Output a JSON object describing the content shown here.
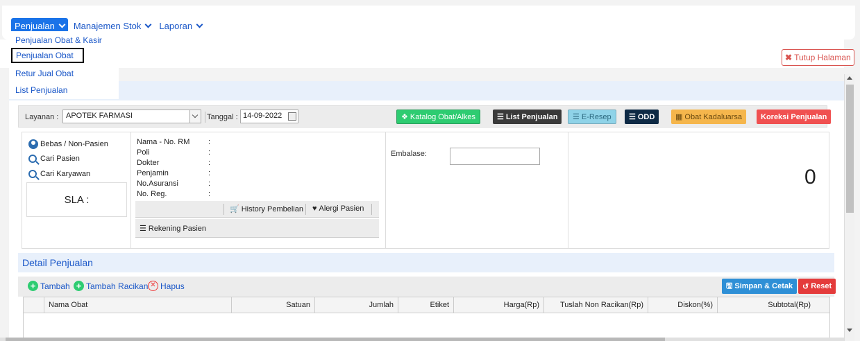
{
  "nav": {
    "items": [
      {
        "label": "Penjualan"
      },
      {
        "label": "Manajemen Stok"
      },
      {
        "label": "Laporan"
      }
    ],
    "dropdown": [
      {
        "label": "Penjualan Obat & Kasir"
      },
      {
        "label": "Penjualan Obat"
      },
      {
        "label": "Retur Jual Obat"
      },
      {
        "label": "List Penjualan"
      }
    ]
  },
  "header": {
    "close_label": "Tutup Halaman"
  },
  "toolbar": {
    "layanan_label": "Layanan :",
    "layanan_value": "APOTEK FARMASI",
    "tanggal_label": "Tanggal :",
    "tanggal_value": "14-09-2022",
    "buttons": {
      "katalog": "Katalog Obat/Alkes",
      "list": "List Penjualan",
      "eresep": "E-Resep",
      "odd": "ODD",
      "kadaluarsa": "Obat Kadaluarsa",
      "koreksi": "Koreksi Penjualan"
    }
  },
  "patient": {
    "options": [
      "Bebas / Non-Pasien",
      "Cari Pasien",
      "Cari Karyawan"
    ],
    "sla": "SLA :",
    "fields": [
      "Nama - No. RM",
      "Poli",
      "Dokter",
      "Penjamin",
      "No.Asuransi",
      "No. Reg."
    ],
    "colon": ":",
    "history": "History Pembelian",
    "alergi": "Alergi Pasien",
    "rekening": "Rekening Pasien",
    "embalase_label": "Embalase:",
    "total": "0"
  },
  "detail": {
    "title": "Detail Penjualan",
    "tambah": "Tambah",
    "tambah_racikan": "Tambah Racikan",
    "hapus": "Hapus",
    "simpan": "Simpan & Cetak",
    "reset": "Reset",
    "columns": [
      "Nama Obat",
      "Satuan",
      "Jumlah",
      "Etiket",
      "Harga(Rp)",
      "Tuslah Non Racikan(Rp)",
      "Diskon(%)",
      "Subtotal(Rp)"
    ]
  }
}
